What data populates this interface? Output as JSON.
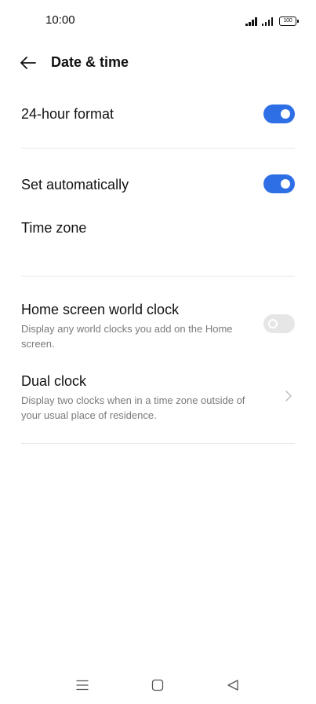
{
  "status_bar": {
    "time": "10:00",
    "battery": "100"
  },
  "header": {
    "title": "Date & time",
    "back_icon": "arrow-left-icon"
  },
  "settings": {
    "format_24h": {
      "title": "24-hour format",
      "enabled": true
    },
    "set_automatically": {
      "title": "Set automatically",
      "enabled": true
    },
    "time_zone": {
      "title": "Time zone"
    },
    "home_world_clock": {
      "title": "Home screen world clock",
      "subtitle": "Display any world clocks you add on the Home screen.",
      "enabled": false
    },
    "dual_clock": {
      "title": "Dual clock",
      "subtitle": "Display two clocks when in a time zone outside of your usual place of residence."
    }
  },
  "colors": {
    "accent": "#2f6fe6",
    "toggle_off": "#e6e6e6",
    "subtitle": "#7a7a7a",
    "divider": "#e8e8e8"
  },
  "nav_bar": {
    "menu_icon": "menu-icon",
    "home_icon": "home-square-icon",
    "back_icon": "back-triangle-icon"
  }
}
